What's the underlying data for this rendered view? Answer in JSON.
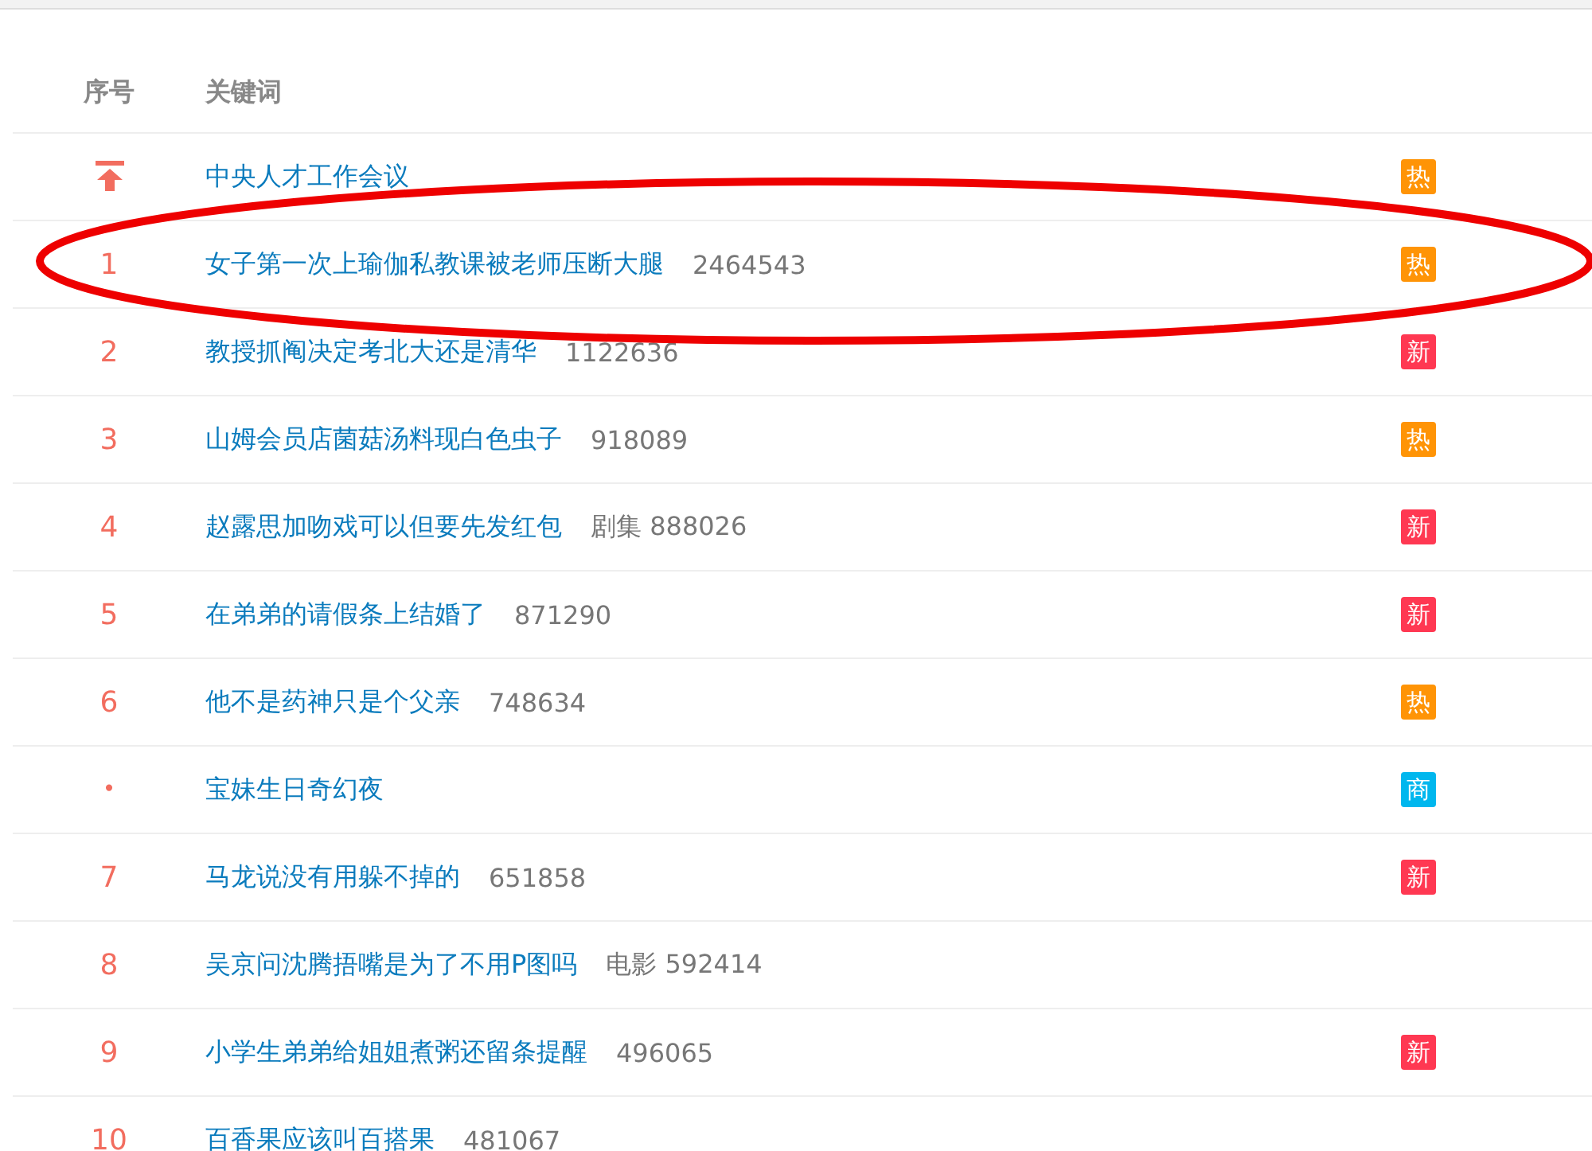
{
  "table": {
    "columns": [
      "序号",
      "关键词"
    ],
    "rows": [
      {
        "kind": "top",
        "keyword": "中央人才工作会议",
        "badge": {
          "text": "热",
          "color": "#ff9406"
        }
      },
      {
        "kind": "number",
        "rank": "1",
        "keyword": "女子第一次上瑜伽私教课被老师压断大腿",
        "extra": "2464543",
        "badge": {
          "text": "热",
          "color": "#ff9406"
        }
      },
      {
        "kind": "number",
        "rank": "2",
        "keyword": "教授抓阄决定考北大还是清华",
        "extra": "1122636",
        "badge": {
          "text": "新",
          "color": "#ff3852"
        }
      },
      {
        "kind": "number",
        "rank": "3",
        "keyword": "山姆会员店菌菇汤料现白色虫子",
        "extra": "918089",
        "badge": {
          "text": "热",
          "color": "#ff9406"
        }
      },
      {
        "kind": "number",
        "rank": "4",
        "keyword": "赵露思加吻戏可以但要先发红包",
        "extra": "剧集 888026",
        "badge": {
          "text": "新",
          "color": "#ff3852"
        }
      },
      {
        "kind": "number",
        "rank": "5",
        "keyword": "在弟弟的请假条上结婚了",
        "extra": "871290",
        "badge": {
          "text": "新",
          "color": "#ff3852"
        }
      },
      {
        "kind": "number",
        "rank": "6",
        "keyword": "他不是药神只是个父亲",
        "extra": "748634",
        "badge": {
          "text": "热",
          "color": "#ff9406"
        }
      },
      {
        "kind": "dot",
        "rank": "•",
        "keyword": "宝妹生日奇幻夜",
        "badge": {
          "text": "商",
          "color": "#00b7ee"
        }
      },
      {
        "kind": "number",
        "rank": "7",
        "keyword": "马龙说没有用躲不掉的",
        "extra": "651858",
        "badge": {
          "text": "新",
          "color": "#ff3852"
        }
      },
      {
        "kind": "number",
        "rank": "8",
        "keyword": "吴京问沈腾捂嘴是为了不用P图吗",
        "extra": "电影 592414"
      },
      {
        "kind": "number",
        "rank": "9",
        "keyword": "小学生弟弟给姐姐煮粥还留条提醒",
        "extra": "496065",
        "badge": {
          "text": "新",
          "color": "#ff3852"
        }
      },
      {
        "kind": "number",
        "rank": "10",
        "keyword": "百香果应该叫百搭果",
        "extra": "481067"
      }
    ]
  }
}
